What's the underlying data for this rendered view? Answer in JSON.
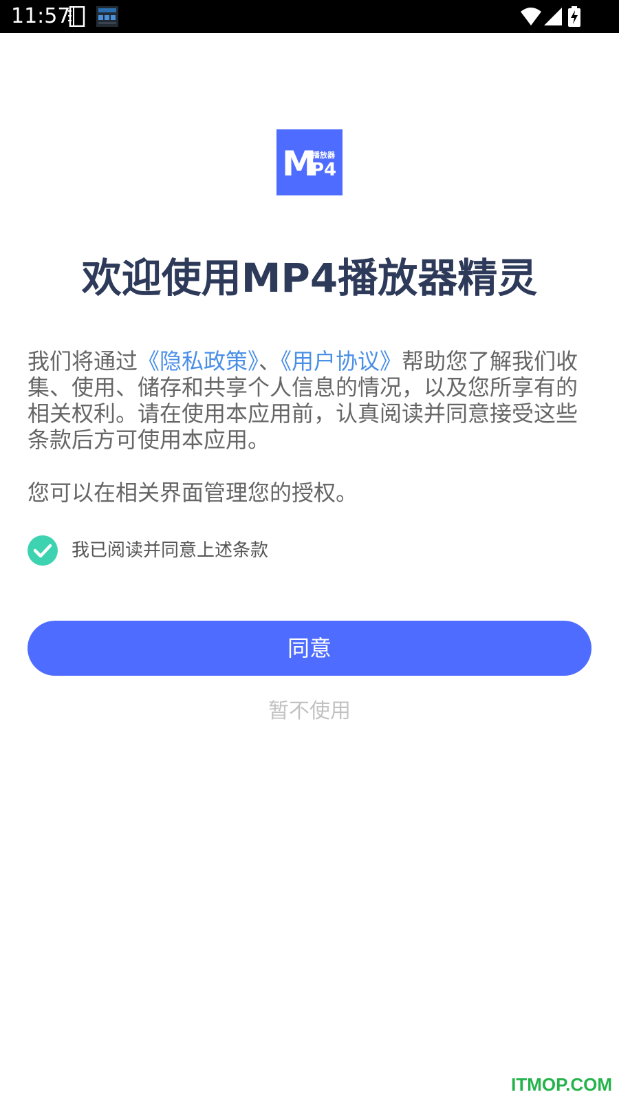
{
  "status_bar": {
    "time": "11:57",
    "icons": [
      "notebook-icon",
      "clock-widget-icon",
      "wifi-icon",
      "signal-icon",
      "battery-charging-icon"
    ]
  },
  "logo": {
    "text_m": "M",
    "text_p4": "P4",
    "text_cn": "播放器",
    "color": "#4e6cff"
  },
  "title": "欢迎使用MP4播放器精灵",
  "privacy": {
    "text_before": "我们将通过",
    "privacy_link": "《隐私政策》",
    "separator": "、",
    "agreement_link": "《用户协议》",
    "text_after": "帮助您了解我们收集、使用、储存和共享个人信息的情况，以及您所享有的相关权利。请在使用本应用前，认真阅读并同意接受这些条款后方可使用本应用。",
    "link_color": "#4a8fe6"
  },
  "auth_note": "您可以在相关界面管理您的授权。",
  "checkbox": {
    "label": "我已阅读并同意上述条款",
    "checked": true,
    "color": "#3ed3b0"
  },
  "buttons": {
    "agree": "同意",
    "decline": "暂不使用",
    "agree_color": "#4e6cff"
  },
  "watermark": "ITMOP.COM"
}
